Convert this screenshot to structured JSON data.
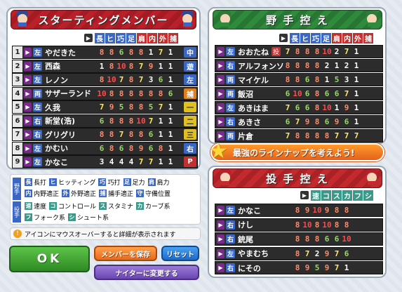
{
  "starting": {
    "title": "スターティングメンバー",
    "cols": [
      "長",
      "ヒ",
      "巧",
      "足",
      "肩",
      "内",
      "外",
      "捕"
    ],
    "rows": [
      {
        "n": "1",
        "hand": "左",
        "name": "やだきた",
        "stats": [
          "8",
          "8",
          "6",
          "8",
          "8",
          "1",
          "7",
          "1"
        ],
        "pos": "中",
        "poscolor": "#3a66c4"
      },
      {
        "n": "2",
        "hand": "左",
        "name": "西森",
        "stats": [
          "1",
          "8",
          "10",
          "8",
          "7",
          "9",
          "1",
          "1"
        ],
        "pos": "遊",
        "poscolor": "#3a66c4"
      },
      {
        "n": "3",
        "hand": "左",
        "name": "レノン",
        "stats": [
          "8",
          "10",
          "7",
          "8",
          "7",
          "3",
          "6",
          "1"
        ],
        "pos": "左",
        "poscolor": "#3a66c4"
      },
      {
        "n": "4",
        "hand": "両",
        "name": "サザーランド",
        "stats": [
          "10",
          "8",
          "8",
          "8",
          "8",
          "8",
          "8",
          "6"
        ],
        "pos": "捕",
        "poscolor": "#e0801c"
      },
      {
        "n": "5",
        "hand": "左",
        "name": "久我",
        "stats": [
          "7",
          "9",
          "5",
          "8",
          "8",
          "5",
          "7",
          "1"
        ],
        "pos": "一",
        "poscolor": "#e0c020"
      },
      {
        "n": "6",
        "hand": "右",
        "name": "新堂(浩)",
        "stats": [
          "6",
          "8",
          "8",
          "8",
          "10",
          "7",
          "1",
          "1"
        ],
        "pos": "二",
        "poscolor": "#e0c020"
      },
      {
        "n": "7",
        "hand": "右",
        "name": "グリグリ",
        "stats": [
          "8",
          "8",
          "7",
          "8",
          "8",
          "6",
          "1",
          "1"
        ],
        "pos": "三",
        "poscolor": "#e0c020"
      },
      {
        "n": "8",
        "hand": "左",
        "name": "かむい",
        "stats": [
          "6",
          "8",
          "6",
          "8",
          "9",
          "6",
          "8",
          "1"
        ],
        "pos": "右",
        "poscolor": "#3a66c4"
      },
      {
        "n": "9",
        "hand": "左",
        "name": "かなこ",
        "stats": [
          "3",
          "4",
          "4",
          "4",
          "7",
          "7",
          "1",
          "1"
        ],
        "pos": "P",
        "poscolor": "#c43030"
      }
    ]
  },
  "bench": {
    "title": "野 手 控 え",
    "cols": [
      "長",
      "ヒ",
      "巧",
      "足",
      "肩",
      "内",
      "外",
      "捕"
    ],
    "rows": [
      {
        "hand": "左",
        "name": "おおたね",
        "flag": "投",
        "stats": [
          "7",
          "8",
          "8",
          "8",
          "10",
          "2",
          "7",
          "1"
        ]
      },
      {
        "hand": "右",
        "name": "アルフォンソ",
        "stats": [
          "8",
          "8",
          "8",
          "8",
          "2",
          "1",
          "2",
          "1"
        ]
      },
      {
        "hand": "両",
        "name": "マイケル",
        "stats": [
          "8",
          "8",
          "6",
          "8",
          "1",
          "5",
          "3",
          "1"
        ]
      },
      {
        "hand": "両",
        "name": "飯沼",
        "stats": [
          "6",
          "10",
          "6",
          "8",
          "6",
          "6",
          "7",
          "1"
        ]
      },
      {
        "hand": "左",
        "name": "あきはま",
        "stats": [
          "7",
          "6",
          "6",
          "8",
          "10",
          "1",
          "9",
          "1"
        ]
      },
      {
        "hand": "右",
        "name": "あきさ",
        "stats": [
          "6",
          "7",
          "9",
          "8",
          "6",
          "9",
          "6",
          "1"
        ]
      },
      {
        "hand": "両",
        "name": "片倉",
        "stats": [
          "7",
          "8",
          "8",
          "8",
          "8",
          "7",
          "7",
          "7"
        ]
      }
    ]
  },
  "banner": "最強のラインナップを考えよう!",
  "pitchers": {
    "title": "投 手 控 え",
    "cols": [
      "速",
      "コ",
      "ス",
      "カ",
      "フ",
      "シ"
    ],
    "rows": [
      {
        "hand": "左",
        "name": "かなこ",
        "stats": [
          "8",
          "9",
          "10",
          "9",
          "8",
          "8"
        ]
      },
      {
        "hand": "右",
        "name": "けし",
        "stats": [
          "8",
          "10",
          "8",
          "10",
          "8",
          "8"
        ]
      },
      {
        "hand": "右",
        "name": "銃尾",
        "stats": [
          "8",
          "8",
          "8",
          "6",
          "6",
          "10"
        ]
      },
      {
        "hand": "左",
        "name": "やまむち",
        "stats": [
          "8",
          "7",
          "2",
          "9",
          "7",
          "6"
        ]
      },
      {
        "hand": "右",
        "name": "にその",
        "stats": [
          "8",
          "9",
          "5",
          "9",
          "7",
          "1"
        ]
      }
    ]
  },
  "legend": {
    "fielder_tag": "野手",
    "pitcher_tag": "投手",
    "fielder": [
      {
        "k": "長",
        "t": "長打",
        "c": "#3a66c4"
      },
      {
        "k": "ヒ",
        "t": "ヒッティング",
        "c": "#3a66c4"
      },
      {
        "k": "巧",
        "t": "巧打",
        "c": "#3a66c4"
      },
      {
        "k": "足",
        "t": "足力",
        "c": "#3a66c4"
      },
      {
        "k": "肩",
        "t": "肩力",
        "c": "#3a66c4"
      },
      {
        "k": "内",
        "t": "内野適正",
        "c": "#3a66c4"
      },
      {
        "k": "外",
        "t": "外野適正",
        "c": "#3a66c4"
      },
      {
        "k": "捕",
        "t": "捕手適正",
        "c": "#3a66c4"
      },
      {
        "k": "守",
        "t": "守備位置",
        "c": "#3a66c4"
      }
    ],
    "pitcher": [
      {
        "k": "速",
        "t": "速度",
        "c": "#3a9a8a"
      },
      {
        "k": "コ",
        "t": "コントロール",
        "c": "#3a9a8a"
      },
      {
        "k": "ス",
        "t": "スタミナ",
        "c": "#3a9a8a"
      },
      {
        "k": "カ",
        "t": "カーブ系",
        "c": "#3a9a8a"
      },
      {
        "k": "フ",
        "t": "フォーク系",
        "c": "#3a9a8a"
      },
      {
        "k": "シ",
        "t": "シュート系",
        "c": "#3a9a8a"
      }
    ]
  },
  "hint": "アイコンにマウスオーバーすると詳細が表示されます",
  "buttons": {
    "ok": "OK",
    "save": "メンバーを保存",
    "reset": "リセット",
    "night": "ナイターに変更する"
  }
}
